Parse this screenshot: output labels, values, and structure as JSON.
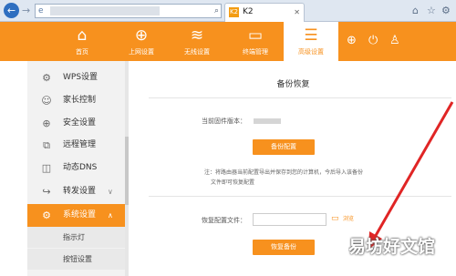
{
  "browser": {
    "tab_title": "K2",
    "tab_favicon": "K2",
    "back_icon": "←",
    "forward_icon": "→",
    "page_icon": "e",
    "search_icon": "⌕",
    "dropdown_icon": "▾",
    "refresh_icon": "↻",
    "stop_icon": "✕",
    "tab_close_icon": "✕",
    "home_icon": "⌂",
    "favorites_icon": "☆",
    "settings_icon": "⚙"
  },
  "topnav": {
    "items": [
      {
        "label": "首页",
        "icon": "home-icon",
        "glyph": "⌂"
      },
      {
        "label": "上网设置",
        "icon": "globe-icon",
        "glyph": "⊕"
      },
      {
        "label": "无线设置",
        "icon": "wifi-icon",
        "glyph": "≋"
      },
      {
        "label": "终端管理",
        "icon": "monitor-icon",
        "glyph": "▭"
      },
      {
        "label": "高级设置",
        "icon": "sliders-icon",
        "glyph": "☰",
        "active": true
      }
    ],
    "plus_glyph": "⊕",
    "power_glyph": "⏻",
    "user_glyph": "♙"
  },
  "sidebar": {
    "items": [
      {
        "label": "WPS设置",
        "glyph": "⚙"
      },
      {
        "label": "家长控制",
        "glyph": "☺"
      },
      {
        "label": "安全设置",
        "glyph": "⊕"
      },
      {
        "label": "远程管理",
        "glyph": "⧉"
      },
      {
        "label": "动态DNS",
        "glyph": "◫"
      },
      {
        "label": "转发设置",
        "glyph": "↪",
        "chevron": "∨"
      },
      {
        "label": "系统设置",
        "glyph": "⚙",
        "chevron": "∧",
        "active": true
      }
    ],
    "subitems": [
      {
        "label": "指示灯"
      },
      {
        "label": "按钮设置"
      }
    ]
  },
  "main": {
    "title": "备份恢复",
    "firmware_label": "当前固件版本：",
    "backup_button": "备份配置",
    "note_line1": "注：将路由器当前配置导出并保存到您的计算机，今后导入该备份",
    "note_line2": "文件即可恢复配置",
    "restore_label": "恢复配置文件：",
    "restore_file_value": "",
    "folder_glyph": "▭",
    "browse_link": "浏览",
    "restore_button": "恢复备份"
  },
  "watermark": "易坊好文馆",
  "colors": {
    "brand_orange": "#f7911e",
    "annotation_red": "#e02525"
  }
}
